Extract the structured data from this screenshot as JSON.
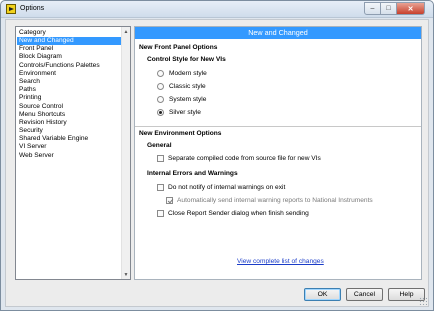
{
  "window": {
    "title": "Options",
    "close_glyph": "✕",
    "min_glyph": "–",
    "max_glyph": "□"
  },
  "categories": {
    "header": "Category",
    "items": [
      "New and Changed",
      "Front Panel",
      "Block Diagram",
      "Controls/Functions Palettes",
      "Environment",
      "Search",
      "Paths",
      "Printing",
      "Source Control",
      "Menu Shortcuts",
      "Revision History",
      "Security",
      "Shared Variable Engine",
      "VI Server",
      "Web Server"
    ],
    "selected_index": 0,
    "scroll_up_glyph": "▲",
    "scroll_down_glyph": "▼"
  },
  "panel": {
    "header": "New and Changed",
    "front_panel": {
      "section_title": "New Front Panel Options",
      "subsection_title": "Control Style for New VIs",
      "options": [
        "Modern style",
        "Classic style",
        "System style",
        "Silver style"
      ],
      "selected": "Silver style"
    },
    "environment": {
      "section_title": "New Environment Options",
      "general_title": "General",
      "separate_compiled": {
        "label": "Separate compiled code from source file for new VIs",
        "checked": false
      },
      "internal_title": "Internal Errors and Warnings",
      "dont_notify": {
        "label": "Do not notify of internal warnings on exit",
        "checked": false
      },
      "auto_send": {
        "label": "Automatically send internal warning reports to National Instruments",
        "checked": true,
        "disabled": true
      },
      "close_report": {
        "label": "Close Report Sender dialog when finish sending",
        "checked": false
      }
    },
    "link_text": "View complete list of changes"
  },
  "buttons": {
    "ok": "OK",
    "cancel": "Cancel",
    "help": "Help"
  },
  "colors": {
    "selection": "#3399ff",
    "link": "#1a3cc8"
  }
}
